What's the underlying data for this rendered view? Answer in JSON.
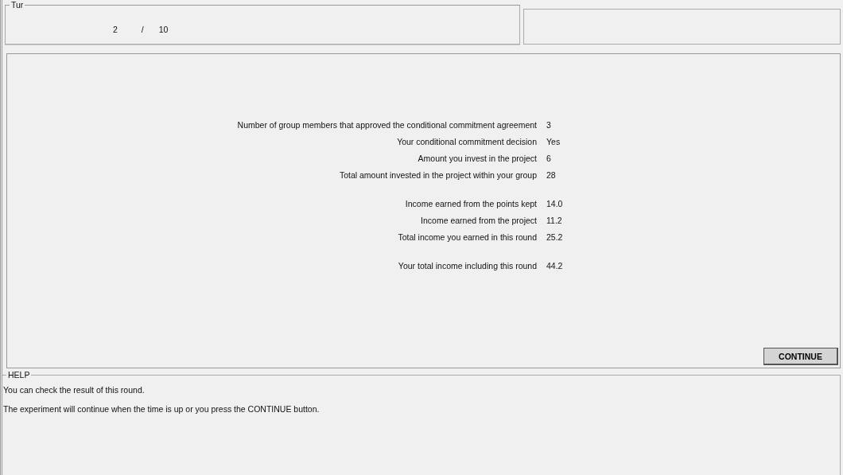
{
  "round_panel": {
    "title": "Tur",
    "current": "2",
    "separator": "/",
    "total": "10"
  },
  "results": [
    [
      {
        "label": "Number of group members that approved the conditional commitment agreement",
        "value": "3"
      },
      {
        "label": "Your conditional commitment decision",
        "value": "Yes"
      },
      {
        "label": "Amount you invest in the project",
        "value": "6"
      },
      {
        "label": "Total amount invested in the project within your group",
        "value": "28"
      }
    ],
    [
      {
        "label": "Income earned from the points kept",
        "value": "14.0"
      },
      {
        "label": "Income earned from the project",
        "value": "11.2"
      },
      {
        "label": "Total income you earned in this round",
        "value": "25.2"
      }
    ],
    [
      {
        "label": "Your total income including this round",
        "value": "44.2"
      }
    ]
  ],
  "continue_button": "CONTINUE",
  "help": {
    "title": "HELP",
    "lines": [
      "You can check the result of this round.",
      "The experiment will continue when the time is up or you press the CONTINUE button."
    ]
  }
}
